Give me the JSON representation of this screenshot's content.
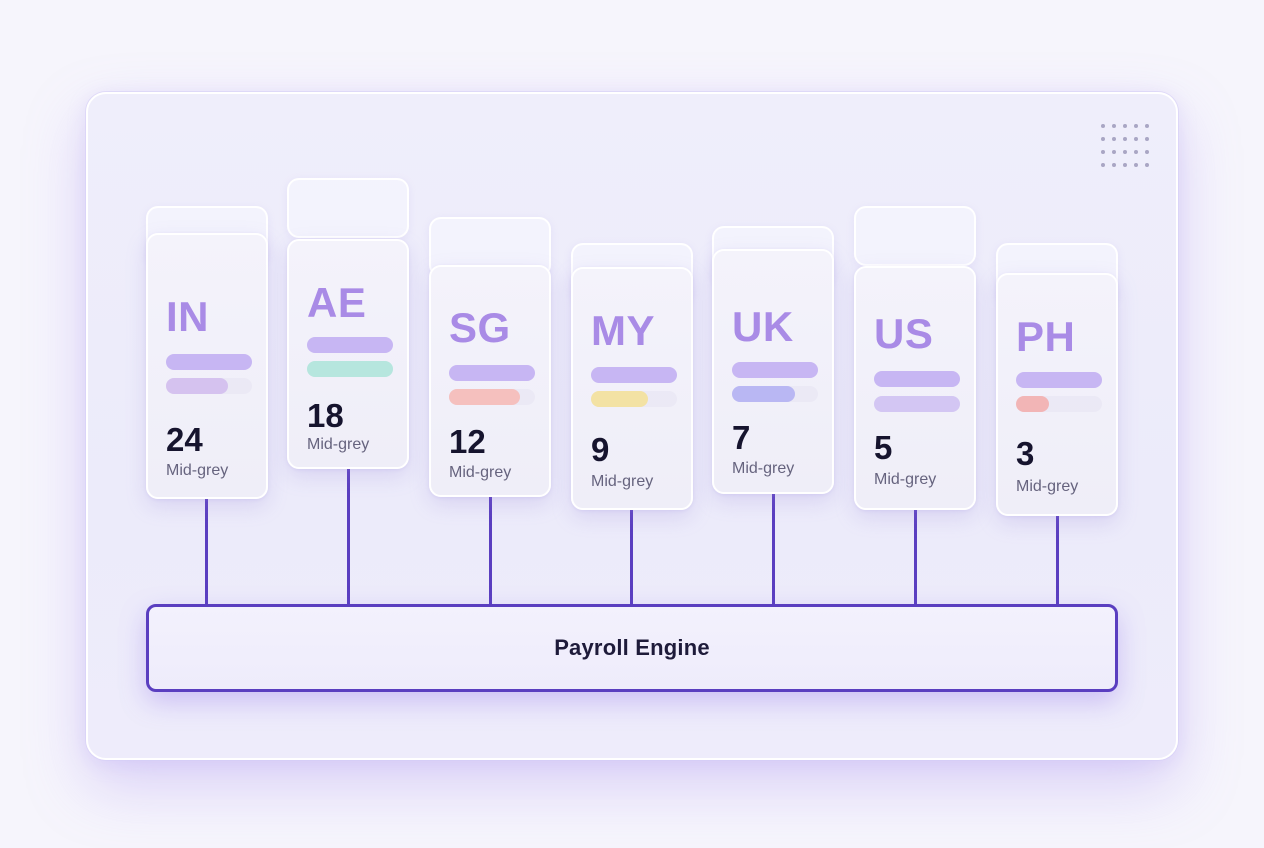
{
  "engine": {
    "label": "Payroll Engine"
  },
  "cards": [
    {
      "code": "IN",
      "count": "24",
      "subtitle": "Mid-grey",
      "bar1_color": "#c7b6f3",
      "bar2_color": "#d5c2ef",
      "bar2_level": 0.72
    },
    {
      "code": "AE",
      "count": "18",
      "subtitle": "Mid-grey",
      "bar1_color": "#c7b6f3",
      "bar2_color": "#b6e6de",
      "bar2_level": 1.0
    },
    {
      "code": "SG",
      "count": "12",
      "subtitle": "Mid-grey",
      "bar1_color": "#c7b6f3",
      "bar2_color": "#f5c0be",
      "bar2_level": 0.82
    },
    {
      "code": "MY",
      "count": "9",
      "subtitle": "Mid-grey",
      "bar1_color": "#c7b6f3",
      "bar2_color": "#f3e2a4",
      "bar2_level": 0.66
    },
    {
      "code": "UK",
      "count": "7",
      "subtitle": "Mid-grey",
      "bar1_color": "#c7b6f3",
      "bar2_color": "#b9b7f3",
      "bar2_level": 0.73
    },
    {
      "code": "US",
      "count": "5",
      "subtitle": "Mid-grey",
      "bar1_color": "#c7b6f3",
      "bar2_color": "#d3c6f3",
      "bar2_level": 1.0
    },
    {
      "code": "PH",
      "count": "3",
      "subtitle": "Mid-grey",
      "bar1_color": "#c7b6f3",
      "bar2_color": "#f2b5b6",
      "bar2_level": 0.38
    }
  ]
}
